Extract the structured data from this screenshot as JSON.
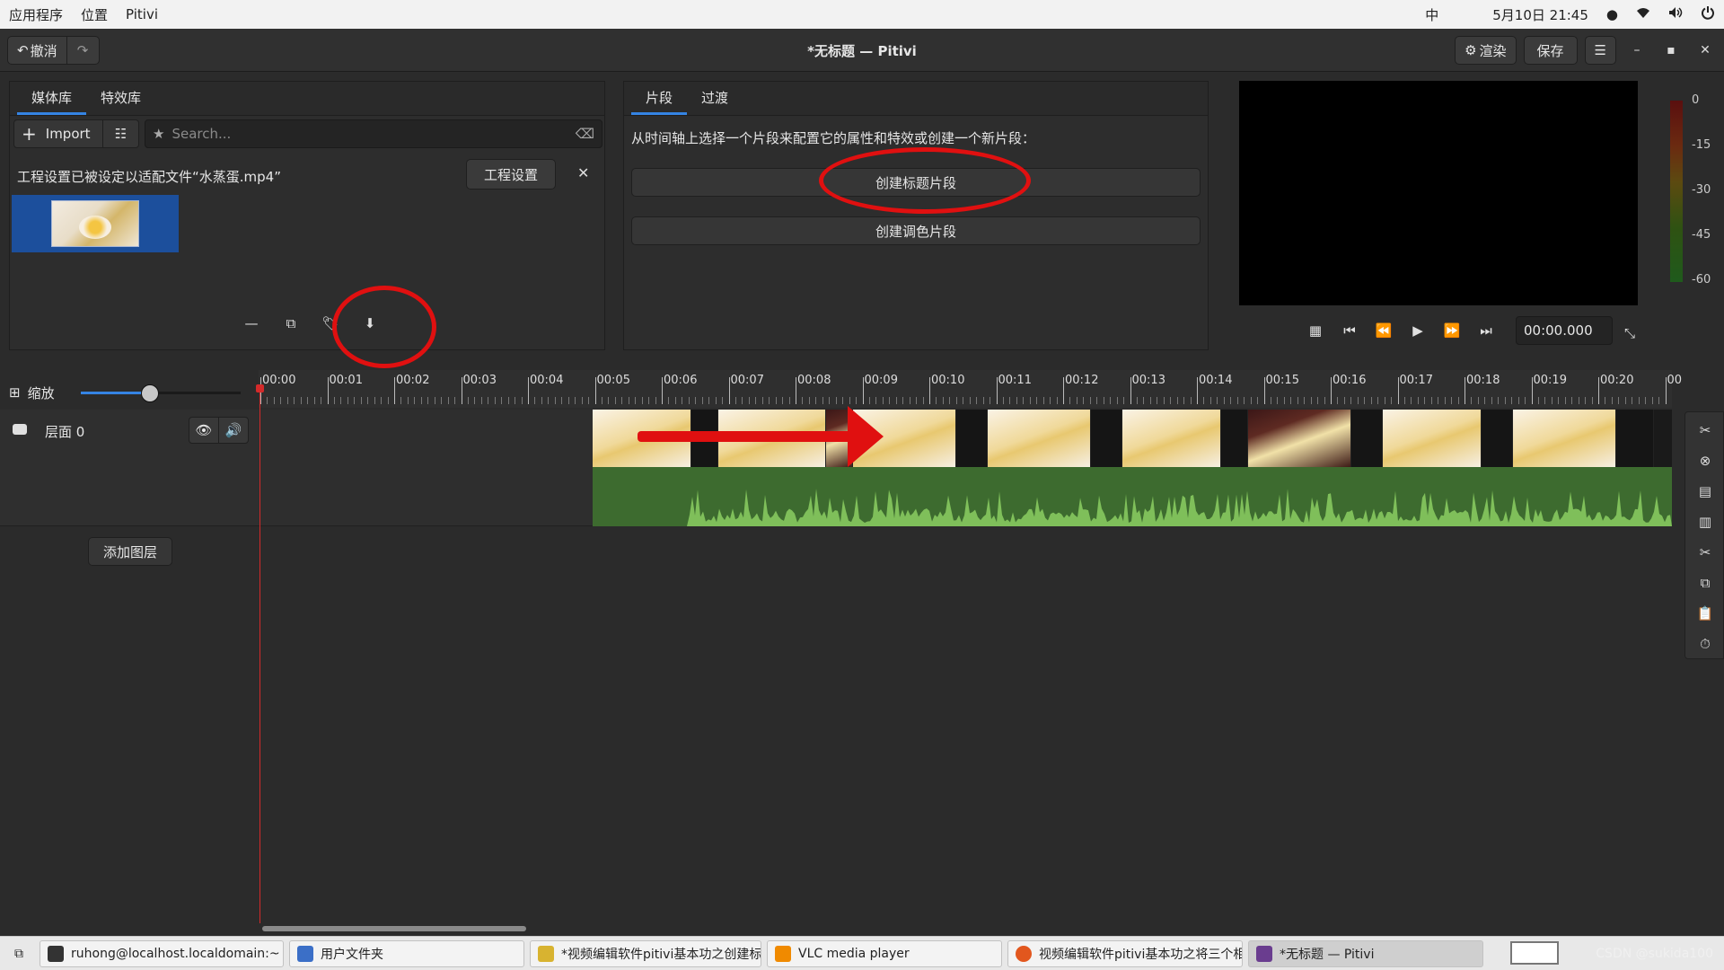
{
  "topbar": {
    "applications": "应用程序",
    "places": "位置",
    "app_name": "Pitivi",
    "input_method": "中",
    "datetime": "5月10日 21:45"
  },
  "header": {
    "undo_label": "撤消",
    "title": "*无标题 — Pitivi",
    "render_label": "渲染",
    "save_label": "保存"
  },
  "media_library": {
    "tabs": [
      "媒体库",
      "特效库"
    ],
    "import_label": "Import",
    "search_placeholder": "Search...",
    "info_message": "工程设置已被设定以适配文件“水蒸蛋.mp4”",
    "project_settings_label": "工程设置"
  },
  "clip_panel": {
    "tabs": [
      "片段",
      "过渡"
    ],
    "hint": "从时间轴上选择一个片段来配置它的属性和特效或创建一个新片段：",
    "create_title_label": "创建标题片段",
    "create_color_label": "创建调色片段"
  },
  "viewer": {
    "timecode": "00:00.000",
    "meter_labels": [
      "0",
      "-15",
      "-30",
      "-45",
      "-60"
    ]
  },
  "timeline": {
    "zoom_label": "缩放",
    "zoom_level": 0.43,
    "ruler_labels": [
      "00:00",
      "00:01",
      "00:02",
      "00:03",
      "00:04",
      "00:05",
      "00:06",
      "00:07",
      "00:08",
      "00:09",
      "00:10",
      "00:11",
      "00:12",
      "00:13",
      "00:14",
      "00:15",
      "00:16",
      "00:17",
      "00:18",
      "00:19",
      "00:20",
      "00"
    ],
    "layer_name": "层面 0",
    "add_layer_label": "添加图层"
  },
  "taskbar": {
    "tasks": [
      "ruhong@localhost.localdomain:~",
      "用户文件夹",
      "*视频编辑软件pitivi基本功之创建标...",
      "VLC media player",
      "视频编辑软件pitivi基本功之将三个相...",
      "*无标题 — Pitivi"
    ],
    "watermark": "CSDN @sukida100"
  },
  "colors": {
    "accent": "#3584e4",
    "annotation": "#e01010",
    "playhead": "#d42a2a",
    "audio_clip": "#3d6b2f"
  }
}
